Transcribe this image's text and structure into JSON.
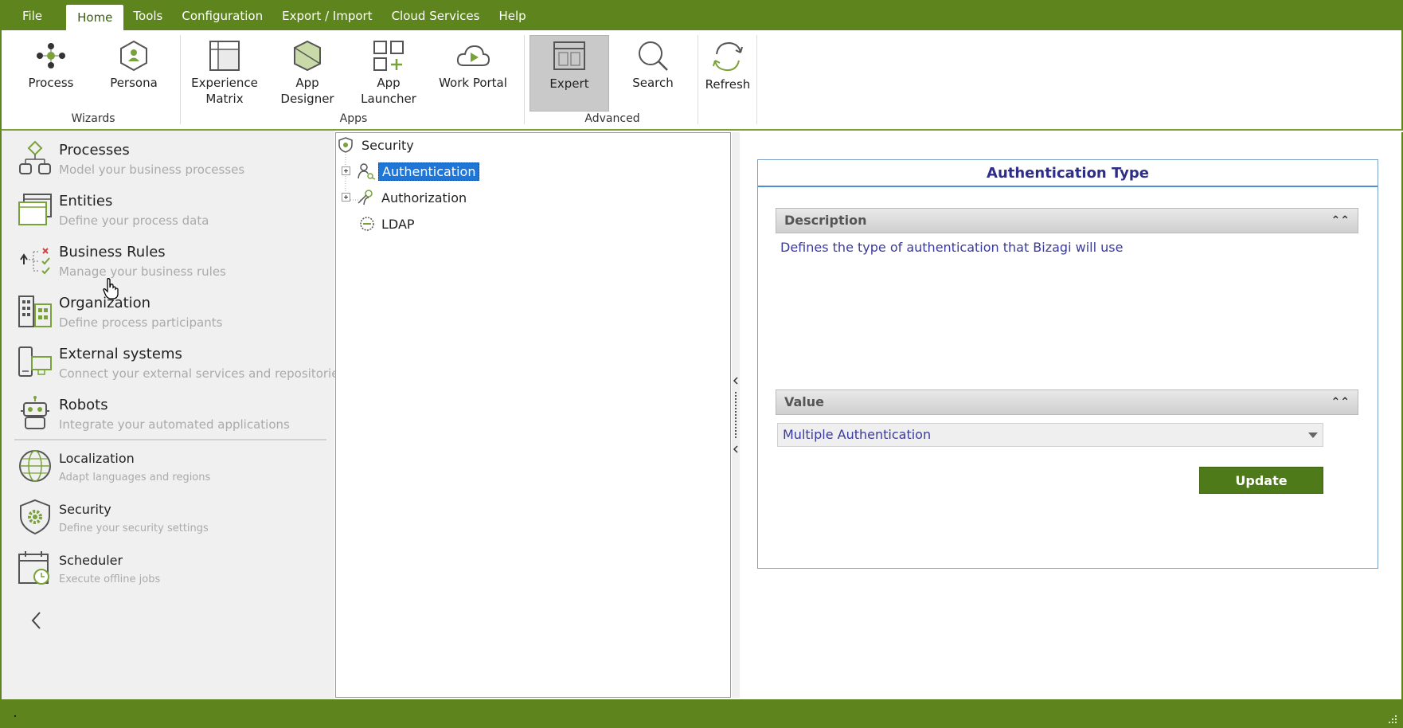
{
  "menu": {
    "items": [
      "File",
      "Home",
      "Tools",
      "Configuration",
      "Export / Import",
      "Cloud Services",
      "Help"
    ],
    "active": "Home"
  },
  "ribbon": {
    "groups": {
      "wizards": "Wizards",
      "apps": "Apps",
      "advanced": "Advanced"
    },
    "buttons": {
      "process": "Process",
      "persona": "Persona",
      "experience_matrix_1": "Experience",
      "experience_matrix_2": "Matrix",
      "app_designer": "App Designer",
      "app_launcher": "App Launcher",
      "work_portal": "Work Portal",
      "expert": "Expert",
      "search": "Search",
      "refresh": "Refresh"
    }
  },
  "nav": {
    "items": [
      {
        "title": "Processes",
        "subtitle": "Model your business processes"
      },
      {
        "title": "Entities",
        "subtitle": "Define your process data"
      },
      {
        "title": "Business Rules",
        "subtitle": "Manage your business rules"
      },
      {
        "title": "Organization",
        "subtitle": "Define process participants"
      },
      {
        "title": "External systems",
        "subtitle": "Connect your external services and repositories"
      },
      {
        "title": "Robots",
        "subtitle": "Integrate your automated applications"
      },
      {
        "title": "Localization",
        "subtitle": "Adapt languages and regions"
      },
      {
        "title": "Security",
        "subtitle": "Define your security settings"
      },
      {
        "title": "Scheduler",
        "subtitle": "Execute offline jobs"
      }
    ]
  },
  "tree": {
    "root": "Security",
    "children": [
      "Authentication",
      "Authorization",
      "LDAP"
    ],
    "selected": "Authentication"
  },
  "property": {
    "title": "Authentication Type",
    "description_header": "Description",
    "description": "Defines the type of authentication that Bizagi will use",
    "value_header": "Value",
    "value": "Multiple Authentication",
    "update_label": "Update"
  },
  "colors": {
    "brand": "#5d841d",
    "selection": "#1f76d6",
    "update_button": "#4e7a1a",
    "title_text": "#2e2e8a"
  }
}
